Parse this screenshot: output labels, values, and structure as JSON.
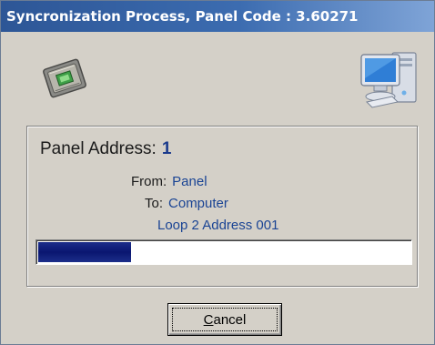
{
  "window": {
    "title": "Syncronization Process, Panel Code : 3.60271"
  },
  "icons": {
    "source": "panel-device-icon",
    "destination": "computer-icon"
  },
  "panel_address": {
    "label": "Panel Address:",
    "value": "1"
  },
  "transfer": {
    "from_label": "From:",
    "from_value": "Panel",
    "to_label": "To:",
    "to_value": "Computer",
    "status": "Loop 2 Address 001"
  },
  "progress": {
    "fraction": 0.25
  },
  "buttons": {
    "cancel_first": "C",
    "cancel_rest": "ancel"
  },
  "colors": {
    "title_gradient_start": "#2d5696",
    "title_gradient_end": "#7fa4d7",
    "progress_fill": "#0a1670",
    "value_text": "#1a4494"
  }
}
